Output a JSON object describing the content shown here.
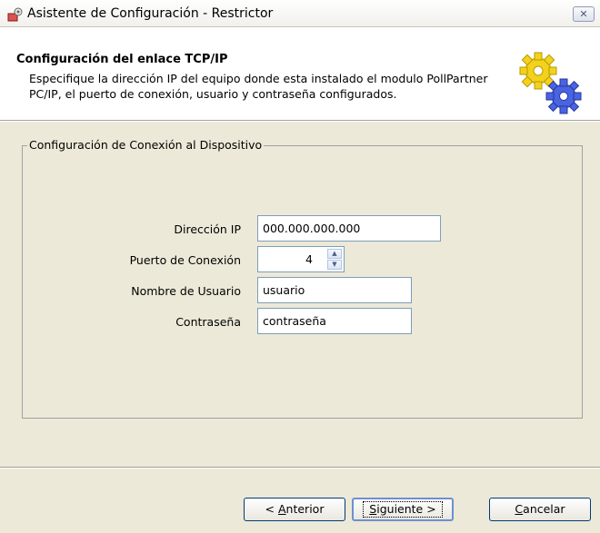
{
  "window": {
    "title": "Asistente de Configuración - Restrictor",
    "close_icon": "close-icon",
    "app_icon": "app-icon"
  },
  "header": {
    "title": "Configuración del enlace TCP/IP",
    "description": "Especifique la dirección IP del equipo donde esta instalado el modulo PollPartner PC/IP, el puerto de conexión, usuario y contraseña configurados.",
    "icon": "gears-icon"
  },
  "group": {
    "legend": "Configuración de Conexión al Dispositivo",
    "fields": {
      "ip": {
        "label": "Dirección IP",
        "value": "000.000.000.000"
      },
      "port": {
        "label": "Puerto de Conexión",
        "value": "4"
      },
      "user": {
        "label": "Nombre de Usuario",
        "value": "usuario"
      },
      "password": {
        "label": "Contraseña",
        "value": "contraseña"
      }
    }
  },
  "buttons": {
    "prev": {
      "pre": "< ",
      "accel": "A",
      "rest": "nterior"
    },
    "next": {
      "pre": "",
      "accel": "S",
      "rest": "iguiente >"
    },
    "cancel": {
      "pre": "",
      "accel": "C",
      "rest": "ancelar"
    }
  },
  "colors": {
    "window_bg": "#ece9d8",
    "header_bg": "#ffffff",
    "field_border": "#7f9db9",
    "gear_yellow": "#f2d21c",
    "gear_blue": "#4a63e0"
  }
}
